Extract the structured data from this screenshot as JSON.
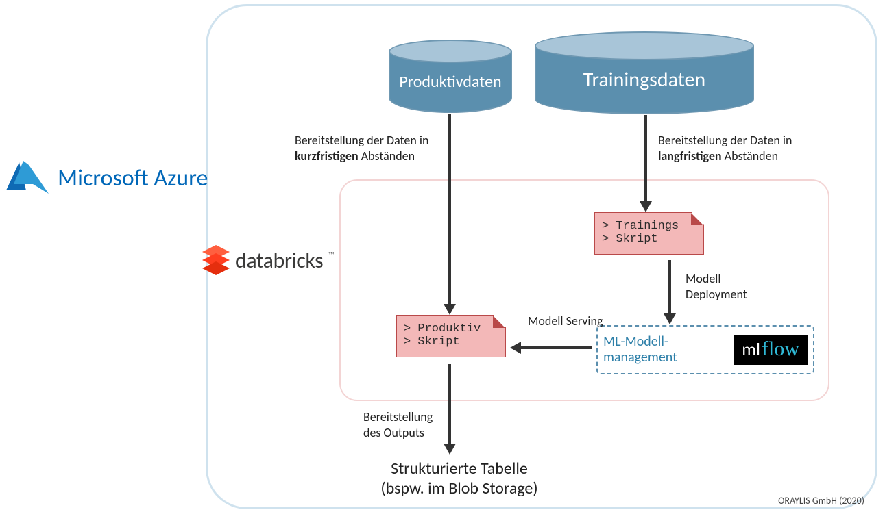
{
  "logos": {
    "azure": "Microsoft Azure",
    "databricks": "databricks"
  },
  "cylinders": {
    "productive": "Produktivdaten",
    "training": "Trainingsdaten"
  },
  "captions": {
    "prod_provision_prefix": "Bereitstellung der Daten in ",
    "prod_provision_bold": "kurzfristigen",
    "prod_provision_suffix": " Abständen",
    "train_provision_prefix": "Bereitstellung der Daten in ",
    "train_provision_bold": "langfristigen",
    "train_provision_suffix": " Abständen",
    "model_deployment": "Modell Deployment",
    "model_serving": "Modell Serving",
    "output_provision": "Bereitstellung des Outputs"
  },
  "scripts": {
    "train_line1": "> Trainings",
    "train_line2": "> Skript",
    "prod_line1": "> Produktiv",
    "prod_line2": "> Skript"
  },
  "mlflow": {
    "label": "ML-Modell-management",
    "badge_ml": "ml",
    "badge_flow": "flow"
  },
  "output": {
    "line1": "Strukturierte Tabelle",
    "line2": "(bspw. im Blob Storage)"
  },
  "attribution": "ORAYLIS GmbH (2020)"
}
